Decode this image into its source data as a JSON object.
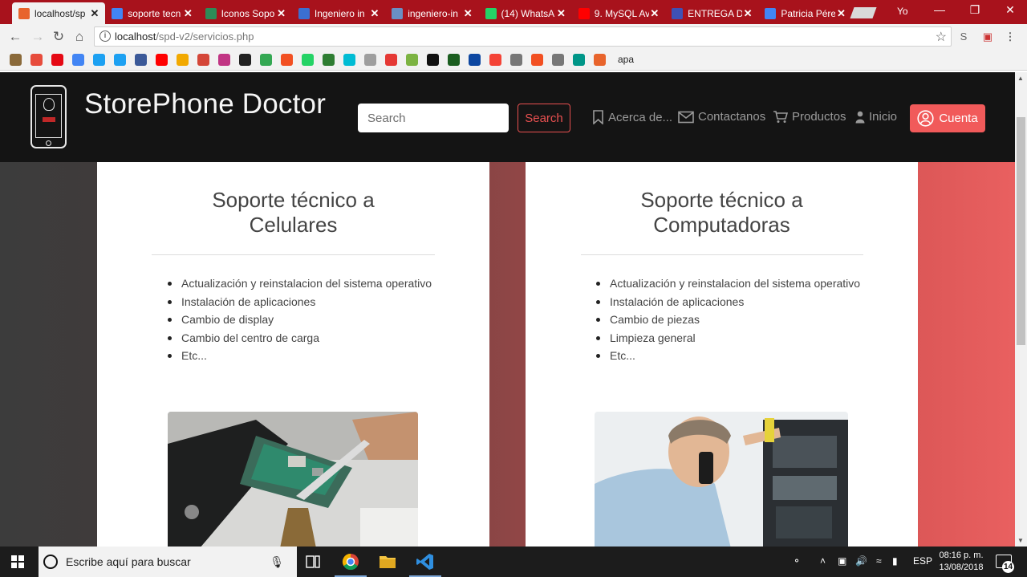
{
  "browser": {
    "tabs": [
      {
        "title": "localhost/sp",
        "color": "#e8642c",
        "active": true
      },
      {
        "title": "soporte tecn",
        "color": "#4285f4",
        "active": false
      },
      {
        "title": "Iconos Sopo",
        "color": "#2e8b57",
        "active": false
      },
      {
        "title": "Ingeniero in",
        "color": "#3b6fd1",
        "active": false
      },
      {
        "title": "ingeniero-in",
        "color": "#6a8fc4",
        "active": false
      },
      {
        "title": "(14) WhatsA",
        "color": "#25d366",
        "active": false
      },
      {
        "title": "9. MySQL Av",
        "color": "#ff0000",
        "active": false
      },
      {
        "title": "ENTREGA D",
        "color": "#3f51b5",
        "active": false
      },
      {
        "title": "Patricia Pére",
        "color": "#4285f4",
        "active": false
      }
    ],
    "profile_label": "Yo",
    "url_host": "localhost",
    "url_path": "/spd-v2/servicios.php",
    "bookmark_last_label": "apa"
  },
  "site": {
    "brand": "StorePhone Doctor",
    "search_placeholder": "Search",
    "search_button": "Search",
    "nav": {
      "about": "Acerca de...",
      "contact": "Contactanos",
      "products": "Productos",
      "home": "Inicio",
      "account": "Cuenta"
    }
  },
  "cards": [
    {
      "title": "Soporte técnico a Celulares",
      "items": [
        "Actualización y reinstalacion del sistema operativo",
        "Instalación de aplicaciones",
        "Cambio de display",
        "Cambio del centro de carga",
        "Etc..."
      ]
    },
    {
      "title": "Soporte técnico a Computadoras",
      "items": [
        "Actualización y reinstalacion del sistema operativo",
        "Instalación de aplicaciones",
        "Cambio de piezas",
        "Limpieza general",
        "Etc..."
      ]
    }
  ],
  "taskbar": {
    "search_placeholder": "Escribe aquí para buscar",
    "language": "ESP",
    "time": "08:16 p. m.",
    "date": "13/08/2018",
    "notifications": "14"
  },
  "colors": {
    "accent": "#f15a5a",
    "navbar": "#141414",
    "tabstrip": "#a8121c"
  }
}
